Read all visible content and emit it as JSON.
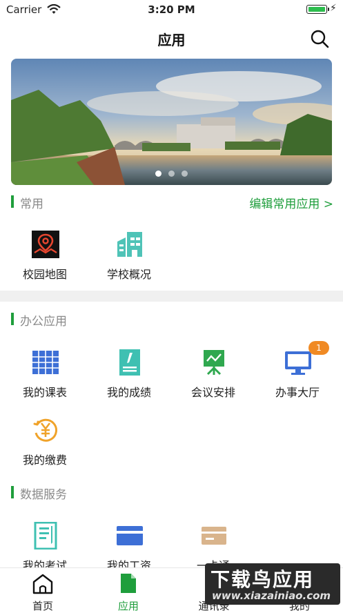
{
  "status_bar": {
    "carrier": "Carrier",
    "time": "3:20 PM"
  },
  "header": {
    "title": "应用"
  },
  "banner": {
    "slide_count": 3,
    "active_slide": 1
  },
  "common": {
    "label": "常用",
    "edit_link": "编辑常用应用 >",
    "apps": [
      {
        "label": "校园地图",
        "icon": "map-pin-icon"
      },
      {
        "label": "学校概况",
        "icon": "building-icon"
      }
    ]
  },
  "office": {
    "label": "办公应用",
    "apps": [
      {
        "label": "我的课表",
        "icon": "calendar-grid-icon"
      },
      {
        "label": "我的成绩",
        "icon": "grade-sheet-icon"
      },
      {
        "label": "会议安排",
        "icon": "meeting-board-icon"
      },
      {
        "label": "办事大厅",
        "icon": "monitor-icon",
        "badge": "1"
      },
      {
        "label": "我的缴费",
        "icon": "yen-coin-icon"
      }
    ]
  },
  "data_services": {
    "label": "数据服务",
    "apps": [
      {
        "label": "我的考试",
        "icon": "exam-doc-icon"
      },
      {
        "label": "我的工资",
        "icon": "salary-card-icon"
      },
      {
        "label": "一卡通",
        "icon": "campus-card-icon"
      }
    ]
  },
  "tabbar": {
    "items": [
      {
        "label": "首页",
        "icon": "home-icon"
      },
      {
        "label": "应用",
        "icon": "apps-doc-icon"
      },
      {
        "label": "通讯录",
        "icon": "contacts-icon"
      },
      {
        "label": "我的",
        "icon": "profile-icon"
      }
    ]
  },
  "watermark": {
    "title": "下载鸟应用",
    "url": "www.xiazainiao.com"
  },
  "colors": {
    "accent": "#1f9e3c",
    "badge": "#f08a24"
  }
}
